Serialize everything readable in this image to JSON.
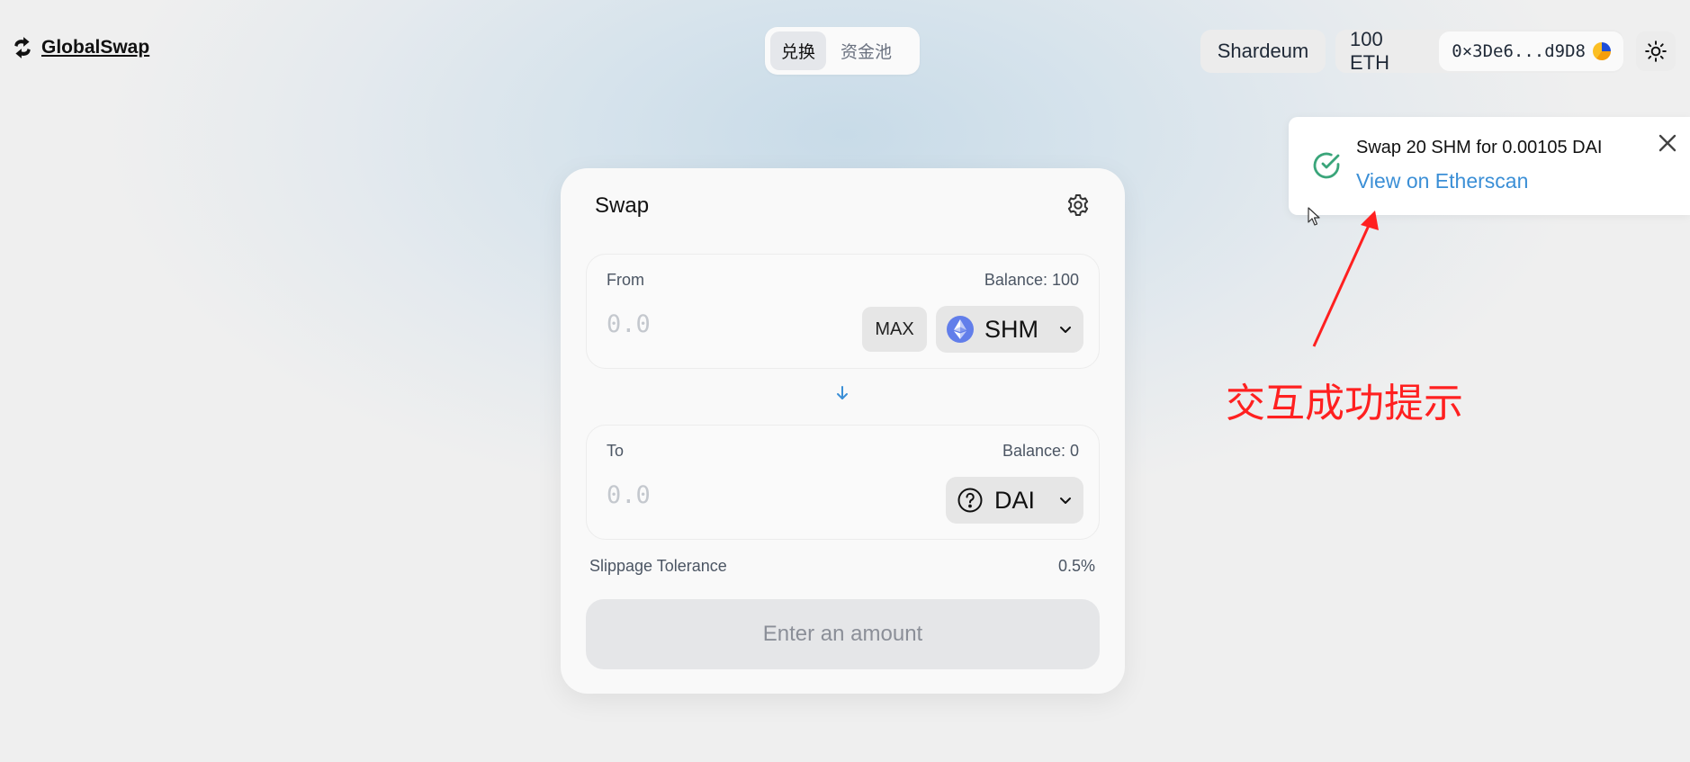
{
  "app": {
    "name": "GlobalSwap"
  },
  "nav": {
    "tabs": [
      {
        "label": "兑换",
        "active": true
      },
      {
        "label": "资金池",
        "active": false
      }
    ]
  },
  "header": {
    "network": "Shardeum",
    "wallet_balance": "100 ETH",
    "wallet_address": "0×3De6...d9D8"
  },
  "toast": {
    "message": "Swap 20 SHM for 0.00105 DAI",
    "link": "View on Etherscan",
    "status_color": "#3aa57a"
  },
  "annotation": {
    "text": "交互成功提示",
    "color": "#ff2020"
  },
  "swap": {
    "title": "Swap",
    "from": {
      "label": "From",
      "balance": "Balance: 100",
      "placeholder": "0.0",
      "max_label": "MAX",
      "token": "SHM"
    },
    "to": {
      "label": "To",
      "balance": "Balance: 0",
      "placeholder": "0.0",
      "token": "DAI"
    },
    "slippage_label": "Slippage Tolerance",
    "slippage_value": "0.5%",
    "cta_label": "Enter an amount"
  },
  "icons": {
    "logo": "swap-logo-icon",
    "theme": "sun-icon",
    "settings": "gear-icon",
    "swap_direction": "arrow-down-icon",
    "toast_status": "check-circle-icon",
    "close": "close-icon",
    "token_shm": "ethereum-icon",
    "token_dai": "question-circle-icon",
    "dropdown": "chevron-down-icon"
  }
}
